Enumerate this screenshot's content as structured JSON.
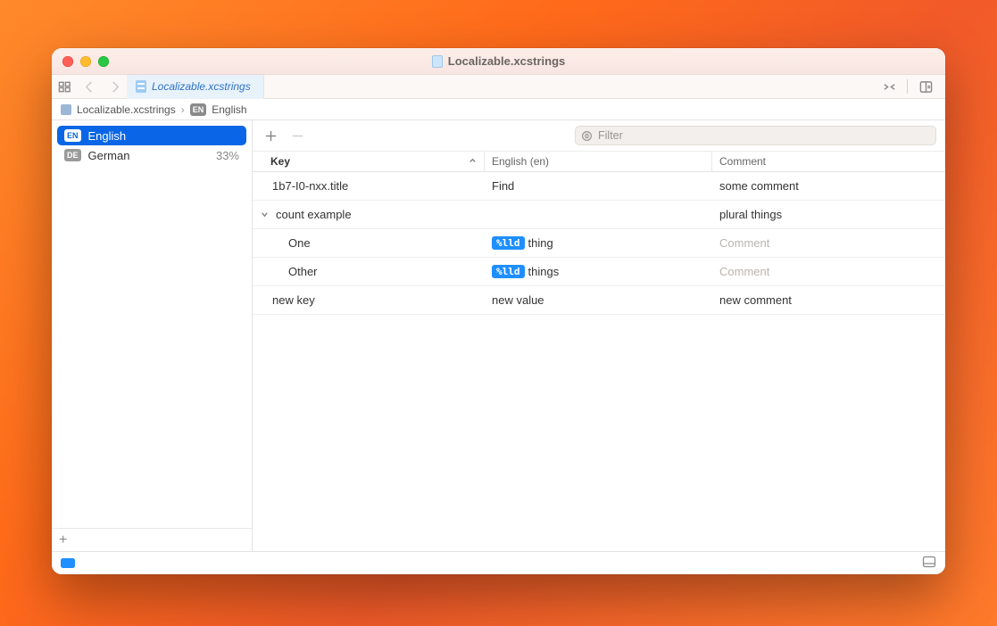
{
  "window": {
    "title": "Localizable.xcstrings"
  },
  "tab": {
    "label": "Localizable.xcstrings"
  },
  "breadcrumb": {
    "file": "Localizable.xcstrings",
    "lang_badge": "EN",
    "lang": "English"
  },
  "sidebar": {
    "items": [
      {
        "badge": "EN",
        "label": "English",
        "selected": true,
        "pct": ""
      },
      {
        "badge": "DE",
        "label": "German",
        "selected": false,
        "pct": "33%"
      }
    ]
  },
  "maintoolbar": {
    "add": "+",
    "remove": "−",
    "filter_placeholder": "Filter"
  },
  "columns": {
    "key": "Key",
    "value": "English (en)",
    "comment": "Comment"
  },
  "rows": [
    {
      "kind": "leaf",
      "key": "1b7-I0-nxx.title",
      "value_token": "",
      "value_text": "Find",
      "comment": "some comment",
      "comment_placeholder": false
    },
    {
      "kind": "parent",
      "key": "count example",
      "value_token": "",
      "value_text": "",
      "comment": "plural things",
      "comment_placeholder": false
    },
    {
      "kind": "child",
      "key": "One",
      "value_token": "%lld",
      "value_text": " thing",
      "comment": "Comment",
      "comment_placeholder": true
    },
    {
      "kind": "child",
      "key": "Other",
      "value_token": "%lld",
      "value_text": " things",
      "comment": "Comment",
      "comment_placeholder": true
    },
    {
      "kind": "leaf",
      "key": "new key",
      "value_token": "",
      "value_text": "new value",
      "comment": "new comment",
      "comment_placeholder": false
    }
  ]
}
